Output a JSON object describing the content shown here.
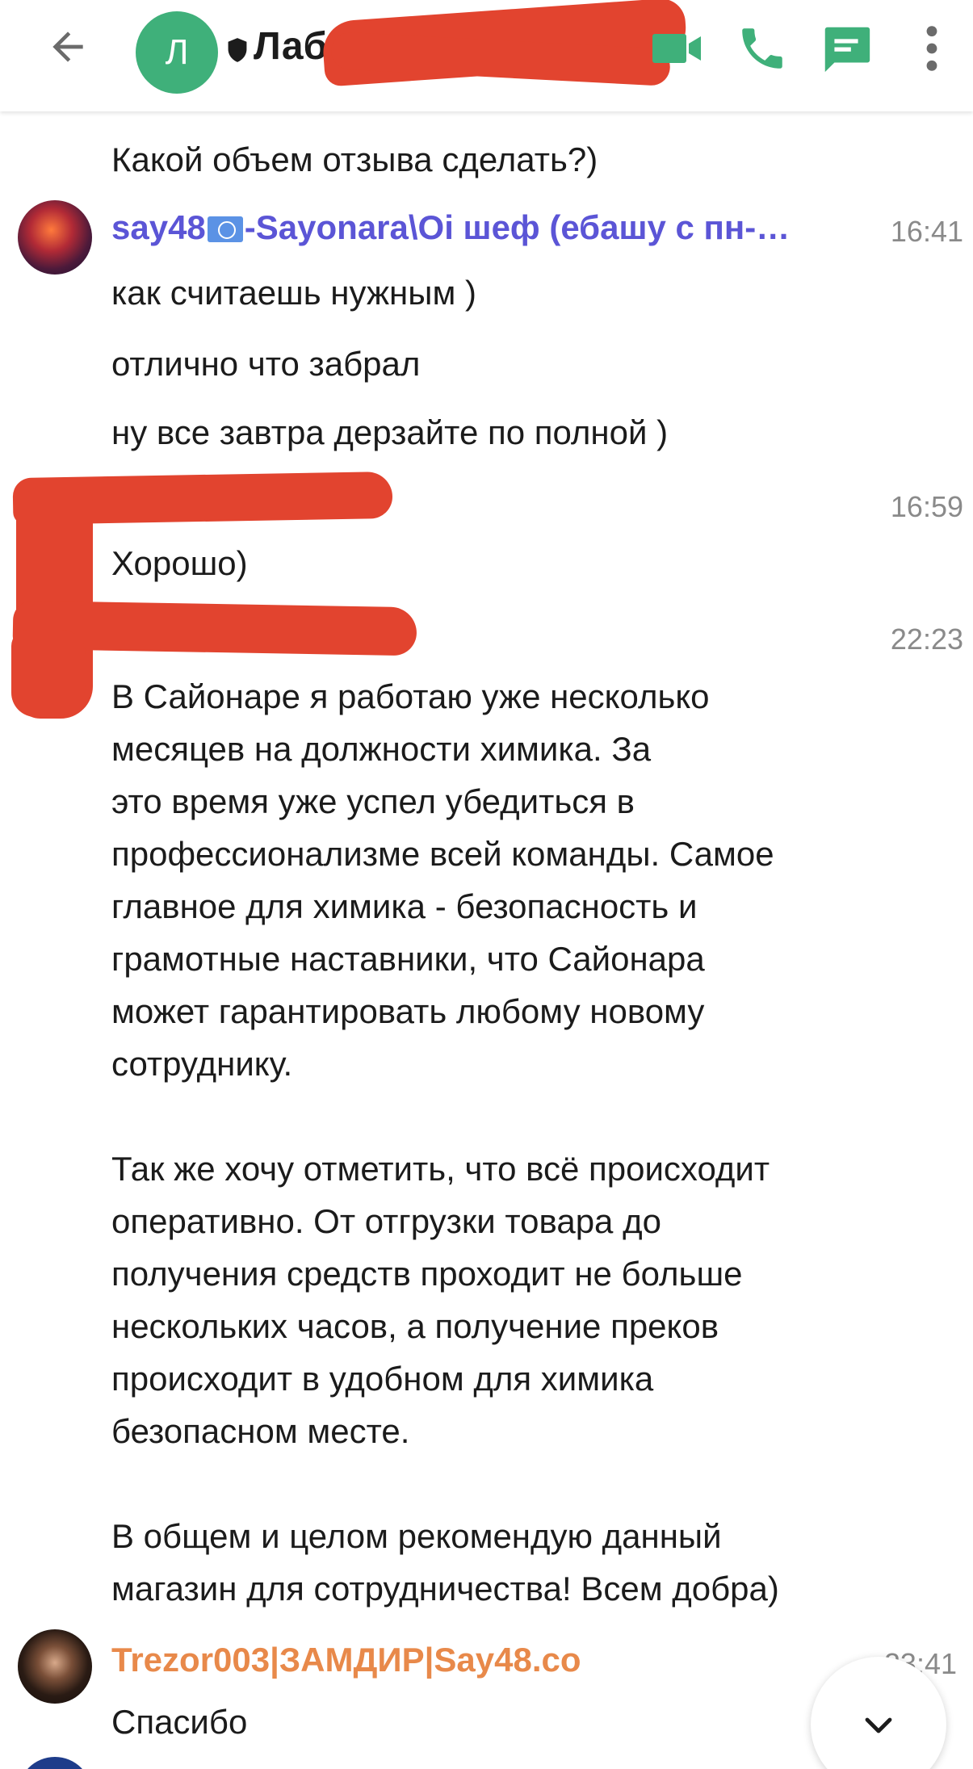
{
  "header": {
    "avatar_letter": "Л",
    "title": "Лаба",
    "colors": {
      "accent": "#3fb07a",
      "icon": "#3fb07a",
      "redaction": "#e2442f"
    },
    "icons": [
      "back-arrow-icon",
      "shield-icon",
      "video-call-icon",
      "phone-icon",
      "chat-icon",
      "more-vertical-icon"
    ]
  },
  "messages": {
    "m1_text": "Какой объем отзыва сделать?)",
    "say48": {
      "name": "say48🇺🇳-Sayonara\\Oi шеф (ебашу с пн-…",
      "name_prefix": "say48",
      "name_suffix": "-Sayonara\\Oi шеф (ебашу с пн-…",
      "name_color": "#5b55d6",
      "time": "16:41",
      "lines": [
        "как считаешь нужным )",
        "отлично что забрал",
        "ну все завтра дерзайте по полной )"
      ]
    },
    "redacted1": {
      "time": "16:59",
      "text": "Хорошо)"
    },
    "redacted2": {
      "time": "22:23",
      "text": "В Сайонаре я работаю уже несколько\nмесяцев на должности химика. За\nэто время уже успел убедиться в\nпрофессионализме всей команды. Самое\nглавное для химика - безопасность и\nграмотные наставники, что Сайонара\nможет гарантировать любому новому\nсотруднику.\n\nТак же хочу отметить, что всё происходит\nоперативно. От отгрузки товара до\nполучения средств проходит не больше\nнескольких часов, а получение преков\nпроисходит в удобном для химика\nбезопасном месте.\n\nВ общем и целом рекомендую данный\nмагазин для сотрудничества! Всем добра)"
    },
    "trezor": {
      "name": "Trezor003|ЗАМДИР|Say48.co",
      "name_color": "#e8894a",
      "time": "23:41",
      "text": "Спасибо"
    }
  },
  "scroll_button": {
    "icon": "chevron-down-icon"
  }
}
